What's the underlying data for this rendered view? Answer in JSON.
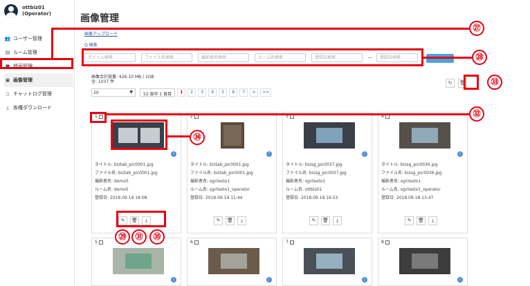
{
  "user": {
    "name": "ottbiz01",
    "role": "(Operator)"
  },
  "menu": [
    {
      "label": "ユーザー管理",
      "icon": "users-icon",
      "glyph": "👥"
    },
    {
      "label": "ルーム管理",
      "icon": "room-icon",
      "glyph": "▤"
    },
    {
      "label": "録画管理",
      "icon": "video-icon",
      "glyph": "■"
    },
    {
      "label": "画像管理",
      "icon": "image-icon",
      "glyph": "▣"
    },
    {
      "label": "チャットログ管理",
      "icon": "document-icon",
      "glyph": "▯"
    },
    {
      "label": "各種ダウンロード",
      "icon": "download-icon",
      "glyph": "⤓"
    }
  ],
  "page": {
    "title": "画像管理",
    "upload_link": "画像アップロード",
    "search_link": "Q 検索"
  },
  "filters": {
    "title": "タイトル検索",
    "filename": "ファイル名検索",
    "photographer": "撮影者名検索",
    "room": "ルーム名検索",
    "date_from": "登録日検索",
    "range_sep": "—",
    "date_to": "登録日検索"
  },
  "storage": {
    "used": "画像合計容量: 426.10 MB / 1GB",
    "count": "全: 1037 件"
  },
  "pager": {
    "per_page": "20",
    "page_info": "52 頁中 1 頁目",
    "pages": [
      "1",
      "2",
      "3",
      "4",
      "5",
      "6",
      "7"
    ],
    "next": ">",
    "last": ">>"
  },
  "callouts": {
    "c27": "㉗",
    "c28": "㉘",
    "c29": "㉙",
    "c31": "㉛",
    "c32": "㉜",
    "c33": "㉝",
    "c34": "㉞",
    "c35": "㉟"
  },
  "cards": [
    {
      "num": "1",
      "title": "タイトル: biztab_pic0001.jpg",
      "file": "ファイル名: biztab_pic0001.jpg",
      "shooter": "撮影者名: demo5",
      "room": "ルーム名: demo5",
      "date": "登録日: 2018.09.19 18:08"
    },
    {
      "num": "2",
      "title": "タイトル: biztab_pic0001.jpg",
      "file": "ファイル名: biztab_pic0001.jpg",
      "shooter": "撮影者名: sgctesto1",
      "room": "ルーム名: sgctesto1_operator",
      "date": "登録日: 2018.09.19 11:44"
    },
    {
      "num": "3",
      "title": "タイトル: bizsg_pic0037.jpg",
      "file": "ファイル名: bizsg_pic0037.jpg",
      "shooter": "撮影者名: sgctesto1",
      "room": "ルーム名: ottbiz01",
      "date": "登録日: 2018.09.18 16:53"
    },
    {
      "num": "4",
      "title": "タイトル: bizsg_pic0036.jpg",
      "file": "ファイル名: bizsg_pic0036.jpg",
      "shooter": "撮影者名: sgctesto1",
      "room": "ルーム名: sgctesto1_operator",
      "date": "登録日: 2018.09.18 13:47"
    },
    {
      "num": "5"
    },
    {
      "num": "6"
    },
    {
      "num": "7"
    },
    {
      "num": "8"
    }
  ]
}
